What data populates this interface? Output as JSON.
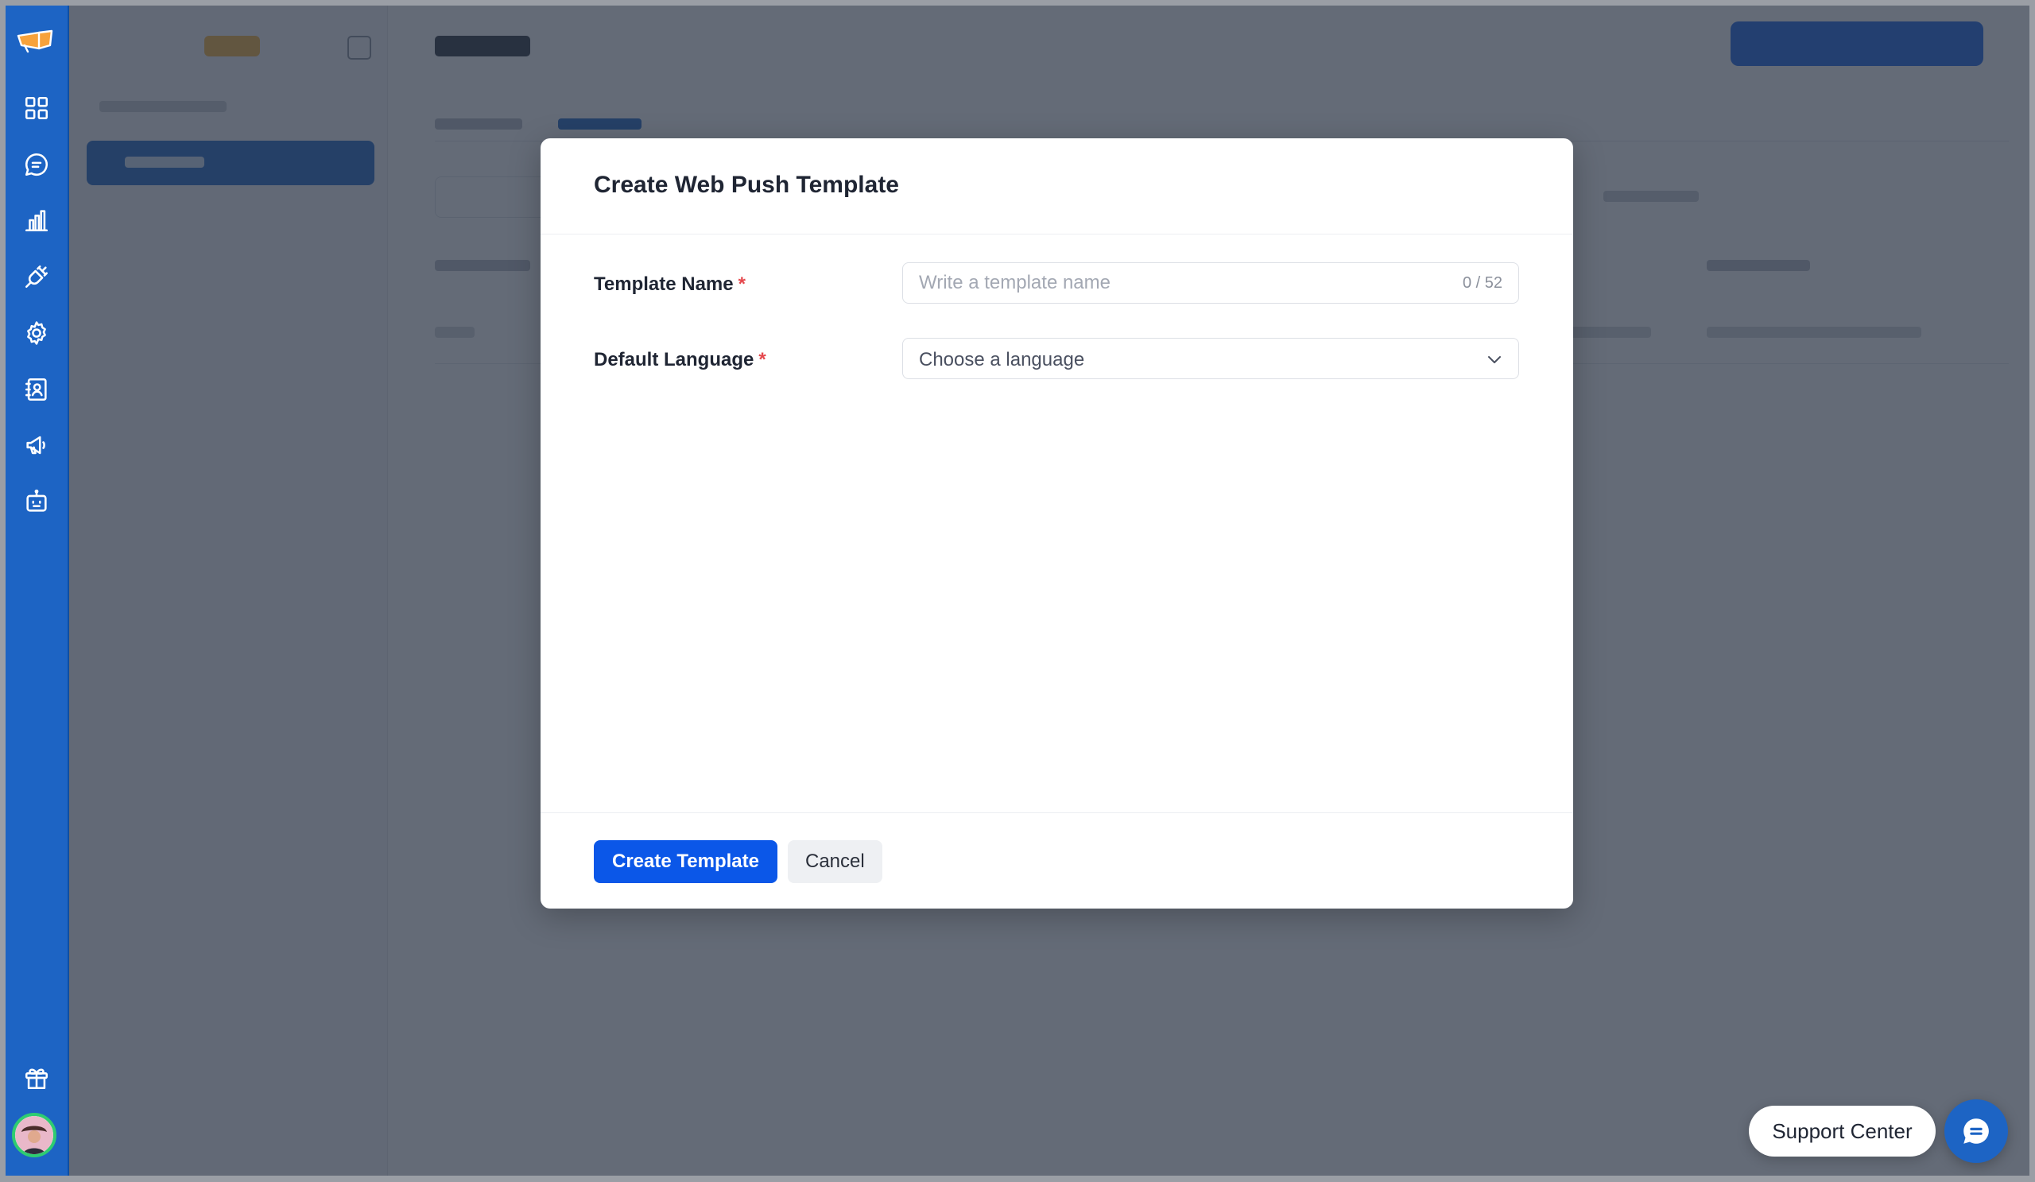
{
  "rail": {
    "items": [
      "logo-icon",
      "dashboard-icon",
      "chat-icon",
      "analytics-icon",
      "integrations-icon",
      "settings-icon",
      "contacts-icon",
      "campaigns-icon",
      "bot-icon",
      "gift-icon",
      "avatar"
    ]
  },
  "modal": {
    "title": "Create Web Push Template",
    "template_name": {
      "label": "Template Name",
      "required_mark": "*",
      "placeholder": "Write a template name",
      "value": "",
      "counter": "0 / 52"
    },
    "default_language": {
      "label": "Default Language",
      "required_mark": "*",
      "selected": "Choose a language"
    },
    "create_label": "Create Template",
    "cancel_label": "Cancel"
  },
  "support": {
    "label": "Support Center"
  },
  "colors": {
    "rail": "#1d64c4",
    "primary_button": "#0b57e8",
    "required": "#e5484d",
    "overlay": "rgba(40, 50, 66, 0.72)"
  }
}
